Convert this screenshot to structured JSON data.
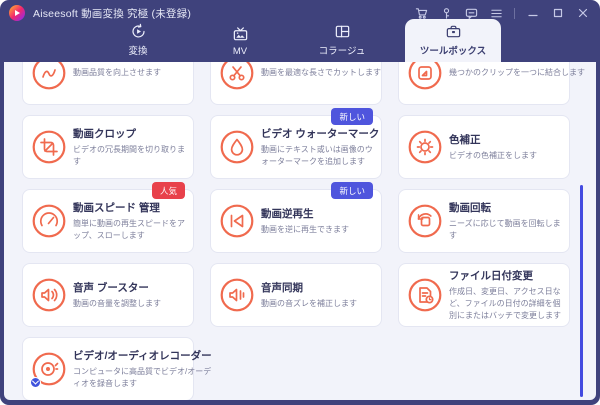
{
  "colors": {
    "frame": "#3f427c",
    "content_bg": "#f2f3fa",
    "icon_accent": "#f06a4e",
    "badge_new": "#4f55dd",
    "badge_hot": "#e8414b",
    "scrollbar": "#434ae0"
  },
  "titlebar": {
    "title": "Aiseesoft 動画変換 究極 (未登録)",
    "icons": [
      "cart-icon",
      "key-icon",
      "feedback-icon",
      "menu-icon"
    ],
    "controls": [
      "minimize",
      "maximize",
      "close"
    ]
  },
  "nav": {
    "tabs": [
      {
        "label": "変換",
        "icon": "convert-icon",
        "active": false
      },
      {
        "label": "MV",
        "icon": "mv-icon",
        "active": false
      },
      {
        "label": "コラージュ",
        "icon": "collage-icon",
        "active": false
      },
      {
        "label": "ツールボックス",
        "icon": "toolbox-icon",
        "active": true
      }
    ]
  },
  "toolbox": {
    "cards": [
      {
        "icon": "video-enhancer-icon",
        "desc": "動画品質を向上させます"
      },
      {
        "icon": "video-cutter-icon",
        "desc": "動画を最適な長さでカットします"
      },
      {
        "icon": "video-merger-icon",
        "desc": "幾つかのクリップを一つに結合します"
      },
      {
        "icon": "crop-icon",
        "title": "動画クロップ",
        "desc": "ビデオの冗長期間を切り取ります"
      },
      {
        "icon": "watermark-icon",
        "title": "ビデオ ウォーターマーク",
        "badge": "新しい",
        "desc": "動画にテキスト或いは画像のウォーターマークを追加します"
      },
      {
        "icon": "color-correction-icon",
        "title": "色補正",
        "desc": "ビデオの色補正をします"
      },
      {
        "icon": "speed-icon",
        "title": "動画スピード 管理",
        "badge": "人気",
        "desc": "簡単に動画の再生スピードをアップ、スローします"
      },
      {
        "icon": "reverse-icon",
        "title": "動画逆再生",
        "badge": "新しい",
        "desc": "動画を逆に再生できます"
      },
      {
        "icon": "rotate-icon",
        "title": "動画回転",
        "desc": "ニーズに応じて動画を回転します"
      },
      {
        "icon": "volume-icon",
        "title": "音声 ブースター",
        "desc": "動画の音量を調整します"
      },
      {
        "icon": "audio-sync-icon",
        "title": "音声同期",
        "desc": "動画の音ズレを補正します"
      },
      {
        "icon": "file-date-icon",
        "title": "ファイル日付変更",
        "desc": "作成日、変更日、アクセス日など、ファイルの日付の詳細を個別にまたはバッチで変更します"
      },
      {
        "icon": "recorder-icon",
        "title": "ビデオ/オーディオレコーダー",
        "desc": "コンピュータに高品質でビデオ/オーディオを録音します"
      }
    ]
  }
}
